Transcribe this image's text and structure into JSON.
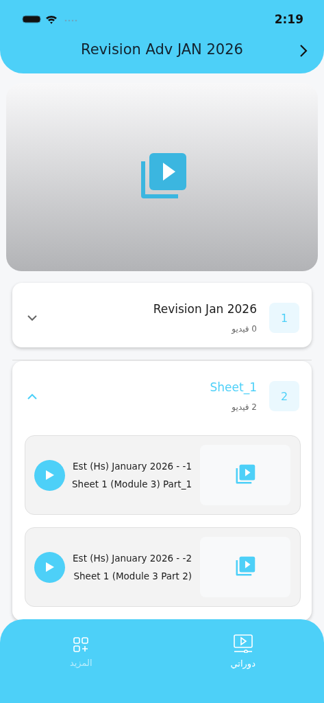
{
  "status_bar": {
    "time": "2:19"
  },
  "header": {
    "title": "Revision Adv JAN 2026"
  },
  "sections": [
    {
      "index": "1",
      "title": "Revision Jan 2026",
      "count": "0 فيديو",
      "expanded": false
    },
    {
      "index": "2",
      "title": "Sheet_1",
      "count": "2 فيديو",
      "expanded": true,
      "lessons": [
        {
          "lines": [
            "Est (Hs) January 2026 - -1",
            "Sheet 1 (Module 3) Part_1"
          ]
        },
        {
          "lines": [
            "Est (Hs) January 2026 - -2",
            "Sheet 1 (Module 3 Part 2)"
          ]
        }
      ]
    }
  ],
  "tab_bar": [
    {
      "label": "دوراتي",
      "kind": "courses",
      "selected": true
    },
    {
      "label": "المزيد",
      "kind": "more",
      "selected": false
    }
  ]
}
